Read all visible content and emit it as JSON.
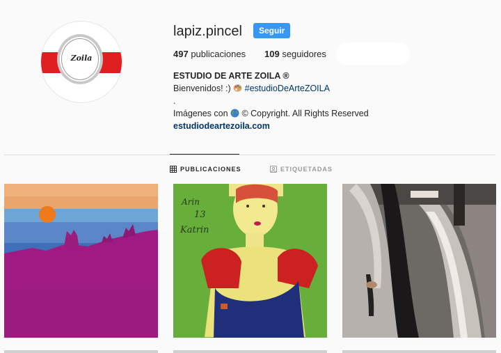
{
  "profile": {
    "username": "lapiz.pincel",
    "follow_label": "Seguir",
    "avatar_text": "Zoila"
  },
  "stats": {
    "posts_count": "497",
    "posts_label": " publicaciones",
    "followers_count": "109",
    "followers_label": " seguidores"
  },
  "bio": {
    "name": "ESTUDIO DE ARTE ZOILA ®",
    "welcome": "Bienvenidos! :) ",
    "hashtag": "#estudioDeArteZOILA",
    "dot": ".",
    "images_prefix": "Imágenes con ",
    "copyright": " © Copyright. All Rights Reserved",
    "link": "estudiodeartezoila.com"
  },
  "tabs": {
    "posts": "PUBLICACIONES",
    "tagged": "ETIQUETADAS"
  },
  "posts": [
    {
      "name": "post-landscape-painting"
    },
    {
      "name": "post-portrait-drawing",
      "inscription_1": "Arin",
      "inscription_2": "13",
      "inscription_3": "Katrin"
    },
    {
      "name": "post-street-photo"
    }
  ],
  "colors": {
    "follow_button": "#3897f0",
    "link": "#003569",
    "avatar_band": "#e02020"
  }
}
